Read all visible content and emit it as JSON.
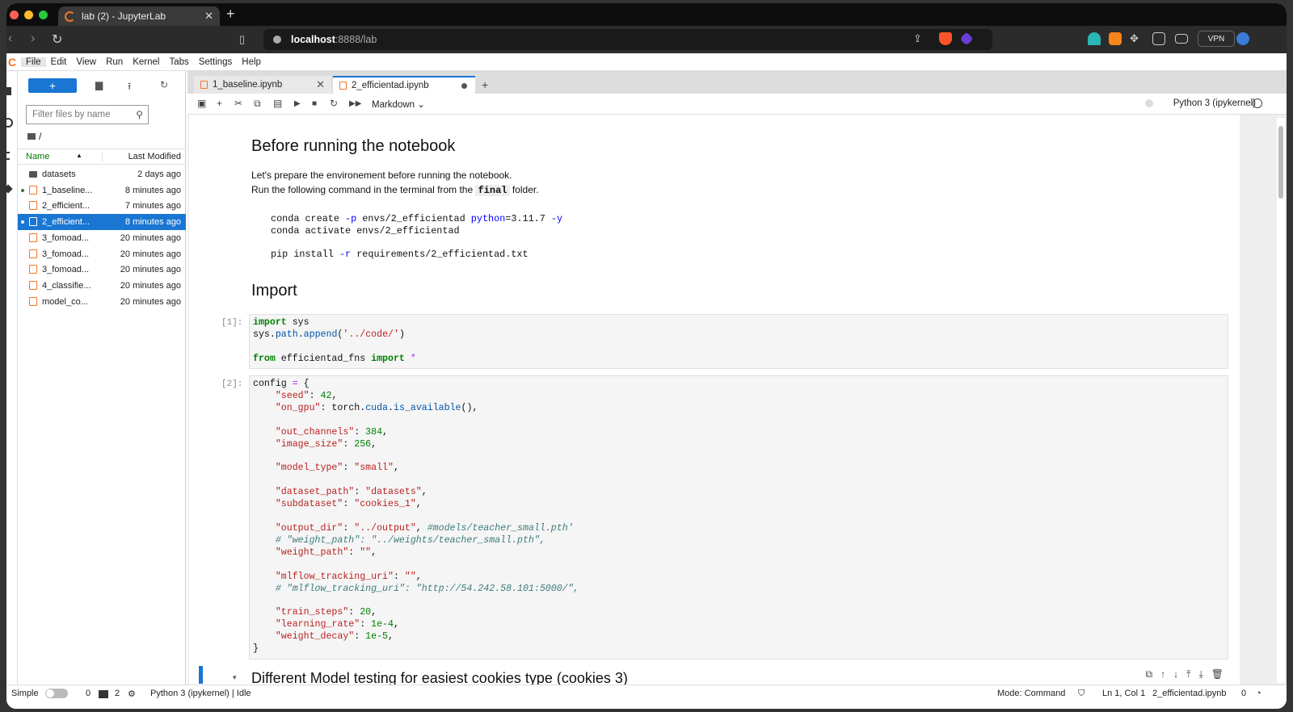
{
  "browser": {
    "tab_title": "lab (2) - JupyterLab",
    "url_host": "localhost",
    "url_rest": ":8888/lab",
    "vpn_label": "VPN",
    "notif_count": "1"
  },
  "menu": [
    "File",
    "Edit",
    "View",
    "Run",
    "Kernel",
    "Tabs",
    "Settings",
    "Help"
  ],
  "filebrowser": {
    "filter_placeholder": "Filter files by name",
    "breadcrumb": "/",
    "col_name": "Name",
    "col_modified": "Last Modified",
    "files": [
      {
        "name": "datasets",
        "modified": "2 days ago",
        "type": "folder",
        "running": false,
        "selected": false
      },
      {
        "name": "1_baseline...",
        "modified": "8 minutes ago",
        "type": "notebook",
        "running": true,
        "selected": false
      },
      {
        "name": "2_efficient...",
        "modified": "7 minutes ago",
        "type": "notebook",
        "running": false,
        "selected": false
      },
      {
        "name": "2_efficient...",
        "modified": "8 minutes ago",
        "type": "notebook",
        "running": true,
        "selected": true
      },
      {
        "name": "3_fomoad...",
        "modified": "20 minutes ago",
        "type": "notebook",
        "running": false,
        "selected": false
      },
      {
        "name": "3_fomoad...",
        "modified": "20 minutes ago",
        "type": "notebook",
        "running": false,
        "selected": false
      },
      {
        "name": "3_fomoad...",
        "modified": "20 minutes ago",
        "type": "notebook",
        "running": false,
        "selected": false
      },
      {
        "name": "4_classifie...",
        "modified": "20 minutes ago",
        "type": "notebook",
        "running": false,
        "selected": false
      },
      {
        "name": "model_co...",
        "modified": "20 minutes ago",
        "type": "notebook",
        "running": false,
        "selected": false
      }
    ]
  },
  "doc_tabs": [
    {
      "label": "1_baseline.ipynb",
      "active": false
    },
    {
      "label": "2_efficientad.ipynb",
      "active": true
    }
  ],
  "toolbar": {
    "cell_type": "Markdown",
    "kernel": "Python 3 (ipykernel)"
  },
  "notebook": {
    "h_before": "Before running the notebook",
    "p1": "Let's prepare the environement before running the notebook.",
    "p2_a": "Run the following command in the terminal from the",
    "p2_code": "final",
    "p2_b": "folder.",
    "bash1": "conda create -p envs/2_efficientad python=3.11.7 -y",
    "bash2": "conda activate envs/2_efficientad",
    "bash3": "pip install -r requirements/2_efficientad.txt",
    "h_import": "Import",
    "cell1_prompt": "[1]:",
    "cell2_prompt": "[2]:",
    "h_next": "Different Model testing for easiest cookies type (cookies 3)"
  },
  "status": {
    "simple": "Simple",
    "zero": "0",
    "two": "2",
    "kernel_status": "Python 3 (ipykernel) | Idle",
    "mode": "Mode: Command",
    "position": "Ln 1, Col 1",
    "filename": "2_efficientad.ipynb",
    "zero2": "0"
  }
}
